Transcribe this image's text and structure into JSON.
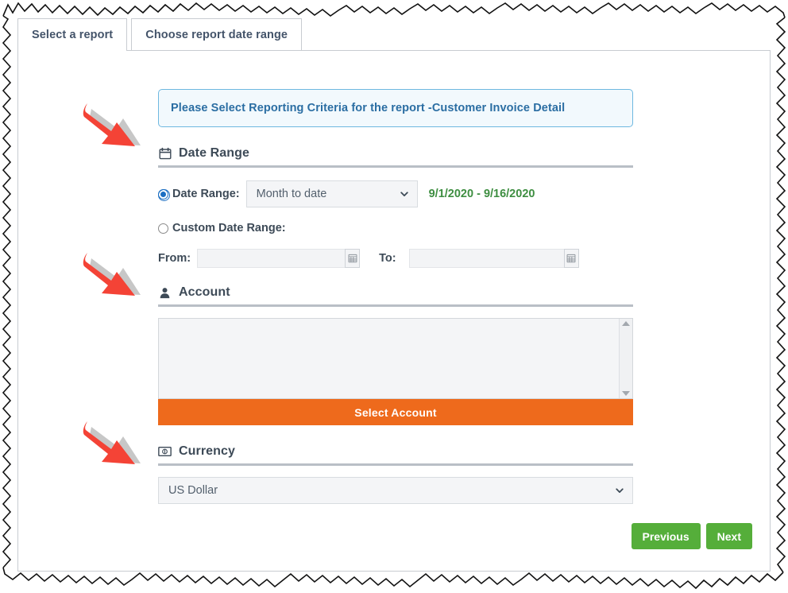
{
  "tabs": [
    {
      "label": "Select a report",
      "active": true
    },
    {
      "label": "Choose report date range",
      "active": false
    }
  ],
  "banner": {
    "text": "Please Select Reporting Criteria for the report -Customer Invoice Detail",
    "border_color": "#6eb8e0",
    "bg_color": "#f2f9fd",
    "text_color": "#2b6ea3"
  },
  "sections": {
    "date_range": {
      "title": "Date Range",
      "icon": "calendar-icon",
      "radio_date_range_label": "Date Range:",
      "radio_date_range_selected": true,
      "dropdown_value": "Month to date",
      "computed_range": "9/1/2020 - 9/16/2020",
      "computed_range_color": "#3e8e41",
      "radio_custom_label": "Custom Date Range:",
      "radio_custom_selected": false,
      "from_label": "From:",
      "from_value": "",
      "from_placeholder": "",
      "to_label": "To:",
      "to_value": "",
      "to_placeholder": ""
    },
    "account": {
      "title": "Account",
      "icon": "user-icon",
      "listbox_items": [],
      "select_button_label": "Select Account",
      "select_button_color": "#ee6a1c"
    },
    "currency": {
      "title": "Currency",
      "icon": "banknote-icon",
      "dropdown_value": "US Dollar"
    }
  },
  "footer": {
    "previous_label": "Previous",
    "next_label": "Next",
    "button_color": "#55ae3a"
  },
  "annotations": {
    "arrow_color": "#f44336",
    "arrows": [
      {
        "target": "date-range-heading"
      },
      {
        "target": "account-heading"
      },
      {
        "target": "currency-heading"
      }
    ]
  }
}
